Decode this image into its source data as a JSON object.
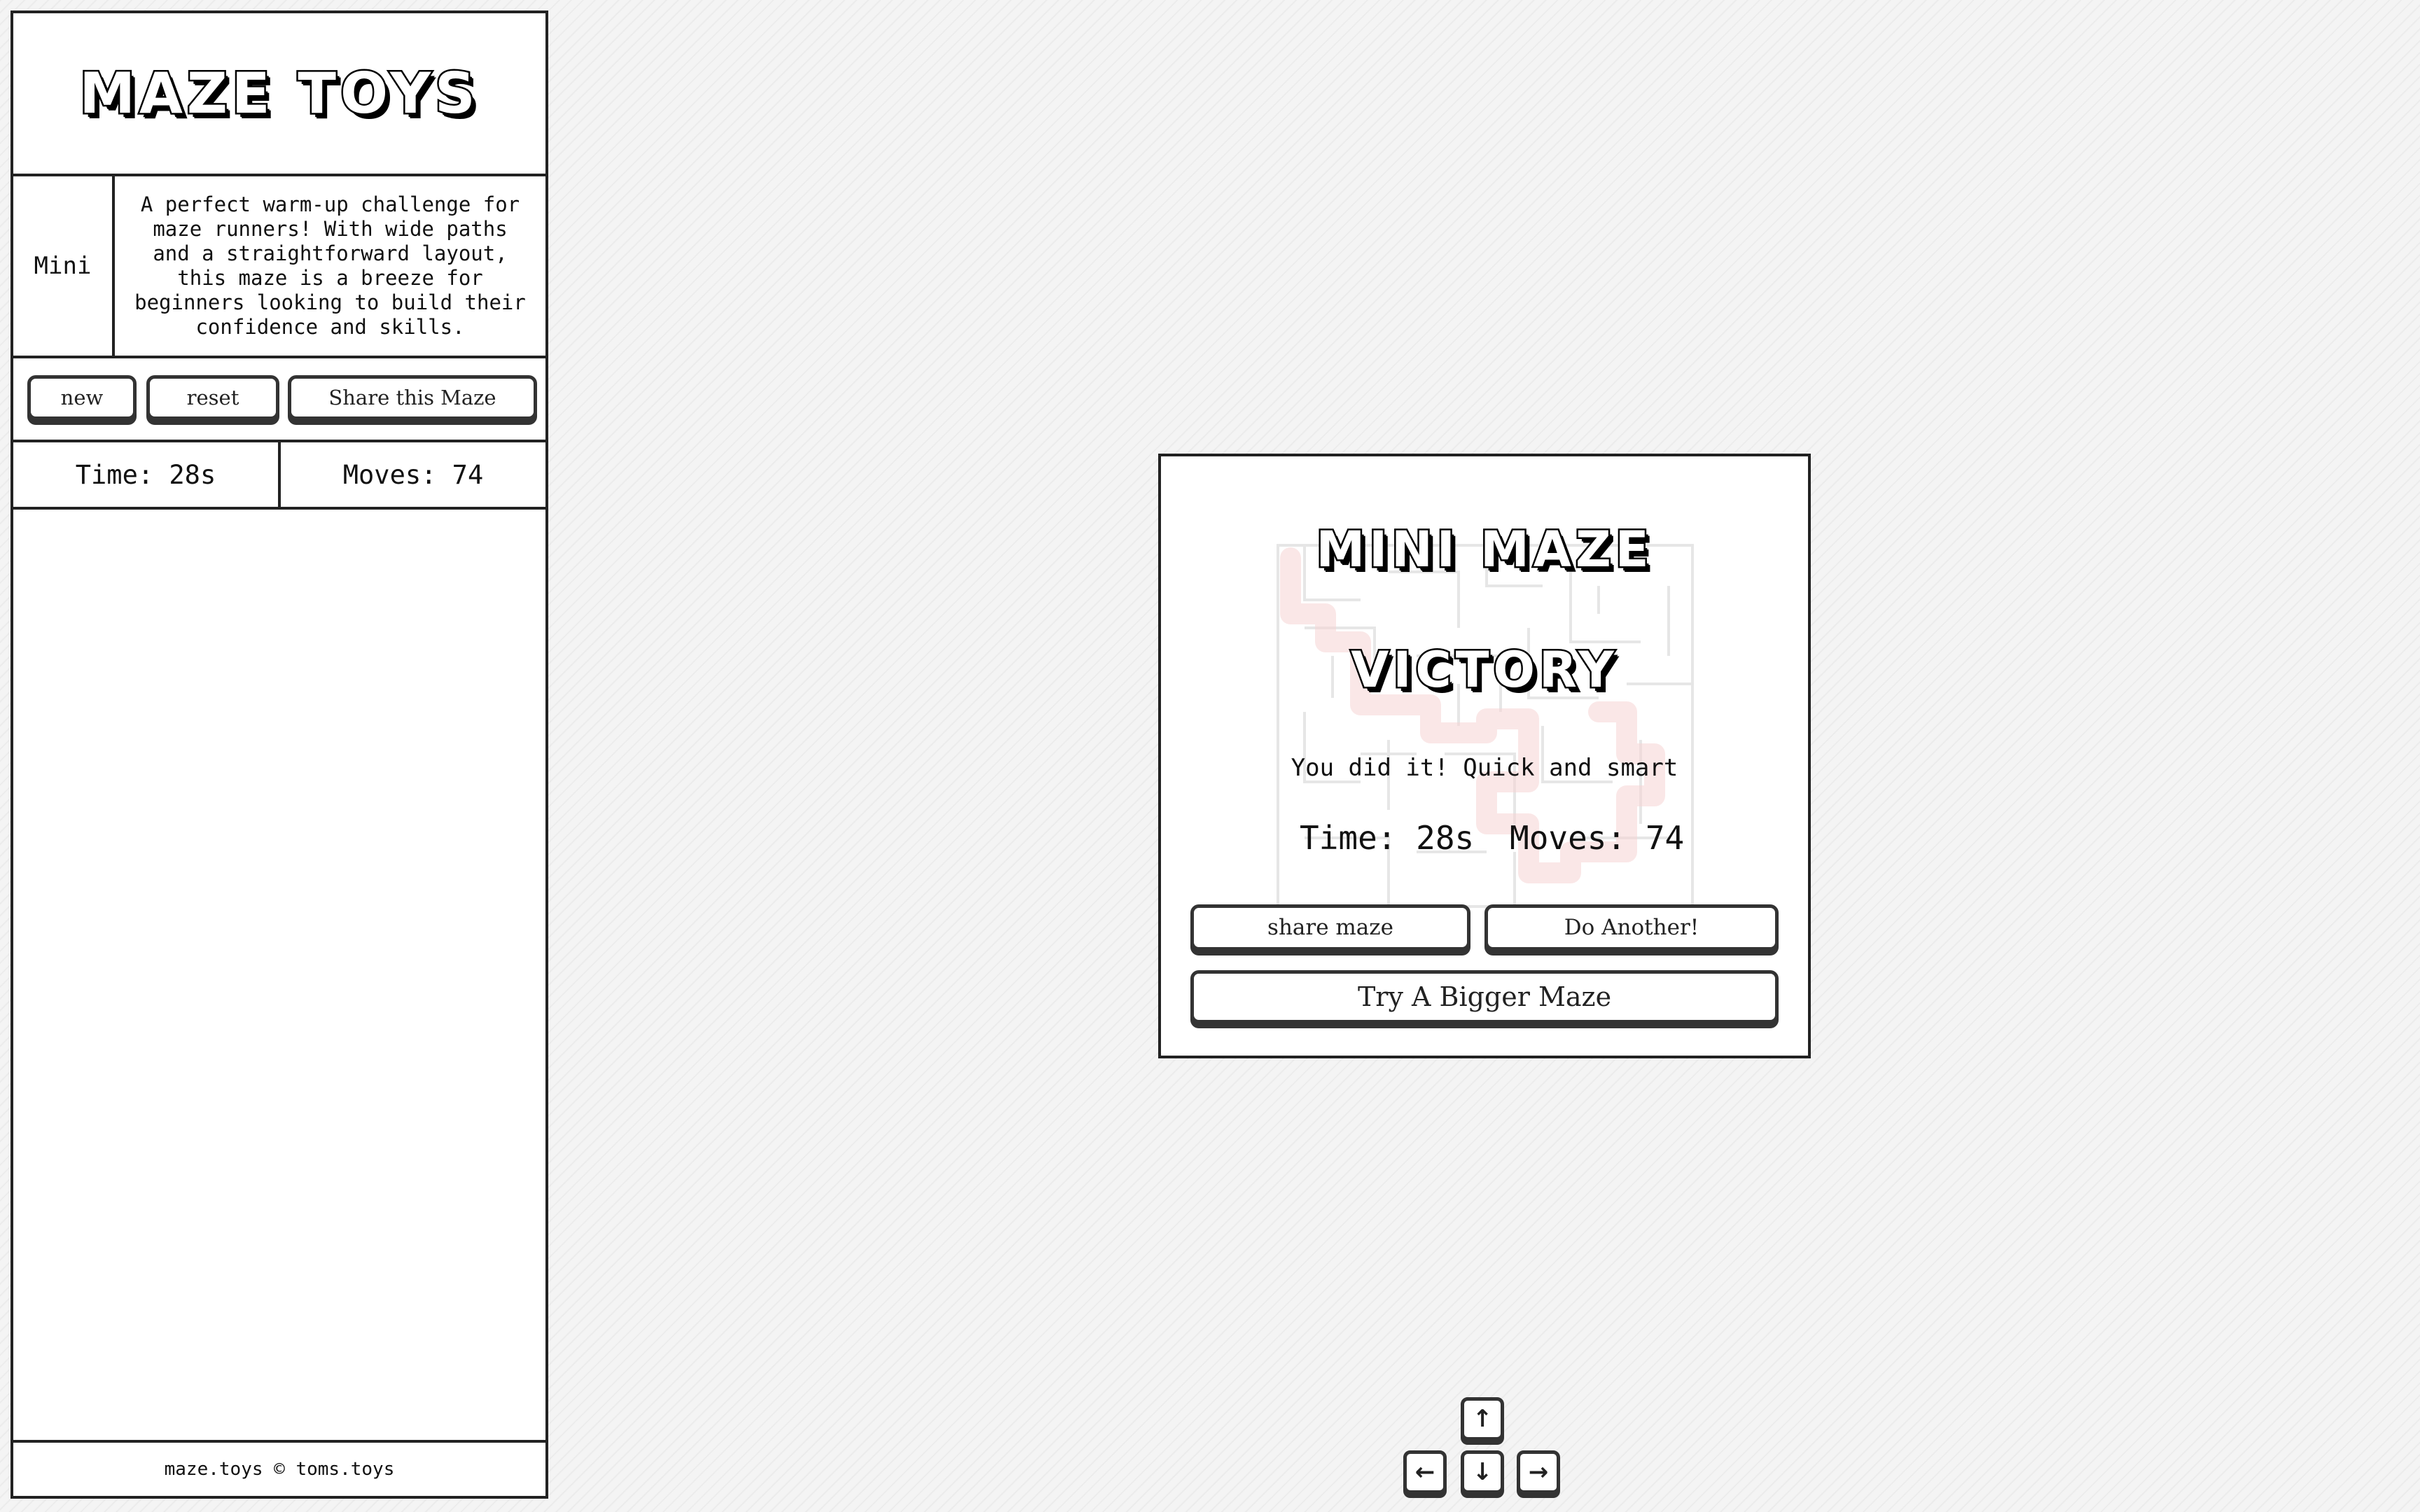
{
  "sidebar": {
    "logo": "MAZE TOYS",
    "level": "Mini",
    "description": "A perfect warm-up challenge for maze runners! With wide paths and a straightforward layout, this maze is a breeze for beginners looking to build their confidence and skills.",
    "buttons": {
      "new": "new",
      "reset": "reset",
      "share": "Share this Maze"
    },
    "time": "Time: 28s",
    "moves": "Moves: 74",
    "footer": "maze.toys © toms.toys"
  },
  "victory": {
    "title_line1": "MINI MAZE",
    "title_line2": "VICTORY",
    "message": "You did it! Quick and smart",
    "time": "Time: 28s",
    "moves": "Moves: 74",
    "buttons": {
      "share": "share maze",
      "another": "Do Another!",
      "bigger": "Try A Bigger Maze"
    }
  },
  "arrow_keys": {
    "up": "↑",
    "left": "←",
    "down": "↓",
    "right": "→"
  },
  "colors": {
    "accent": "#222222",
    "maze_path": "#f3c3c3",
    "maze_walls": "#e4e4e4",
    "background": "#f4f4f4"
  }
}
